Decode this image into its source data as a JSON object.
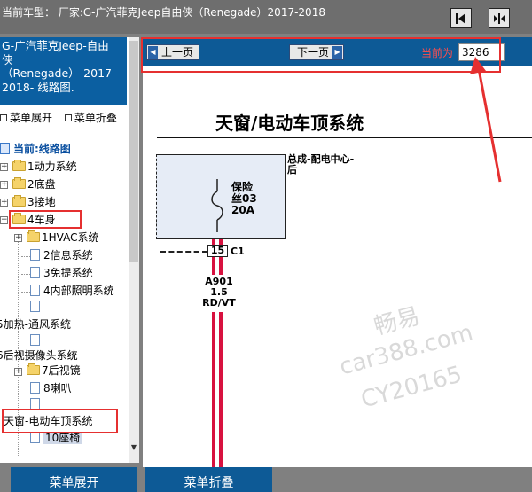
{
  "header": {
    "car_model": "当前车型：  厂家:G-广汽菲克Jeep自由侠（Renegade）2017-2018"
  },
  "sidebar": {
    "title_lines": [
      "G-广汽菲克Jeep-自由",
      "侠",
      "（Renegade）-2017-",
      "2018- 线路图."
    ],
    "expand_all": "菜单展开",
    "collapse_all": "菜单折叠",
    "tree": {
      "root": "当前:线路图",
      "n1": "1动力系统",
      "n2": "2底盘",
      "n3": "3接地",
      "n4": "4车身",
      "n4_1": "1HVAC系统",
      "n4_2": "2信息系统",
      "n4_3": "3免提系统",
      "n4_4": "4内部照明系统",
      "n4_5": "5加热-通风系统",
      "n4_6": "6后视摄像头系统",
      "n4_7": "7后视镜",
      "n4_8": "8喇叭",
      "n4_9": "天窗-电动车顶系统",
      "n4_10": "10座椅"
    }
  },
  "pager": {
    "prev_label": "上一页",
    "next_label": "下一页",
    "current_label": "当前为",
    "current_value": "3286"
  },
  "diagram": {
    "title": "天窗/电动车顶系统",
    "panel_label_line1": "总成-配电中心-",
    "panel_label_line2": "后",
    "fuse_line1": "保险",
    "fuse_line2": "丝03",
    "fuse_line3": "20A",
    "pin": "15",
    "connector": "C1",
    "wire_line1": "A901",
    "wire_line2": "1.5",
    "wire_line3": "RD/VT",
    "watermark_line1": "畅易",
    "watermark_line2": "car388.com",
    "watermark_line3": "CY20165"
  },
  "footer": {
    "expand_label": "菜单展开",
    "collapse_label": "菜单折叠"
  },
  "colors": {
    "nav_blue": "#0d5a96",
    "highlight_red": "#e53030",
    "wire_red": "#d8113f"
  },
  "icons": [
    "first-page-icon",
    "fit-page-icon",
    "folder-icon",
    "document-icon",
    "expand-icon"
  ]
}
